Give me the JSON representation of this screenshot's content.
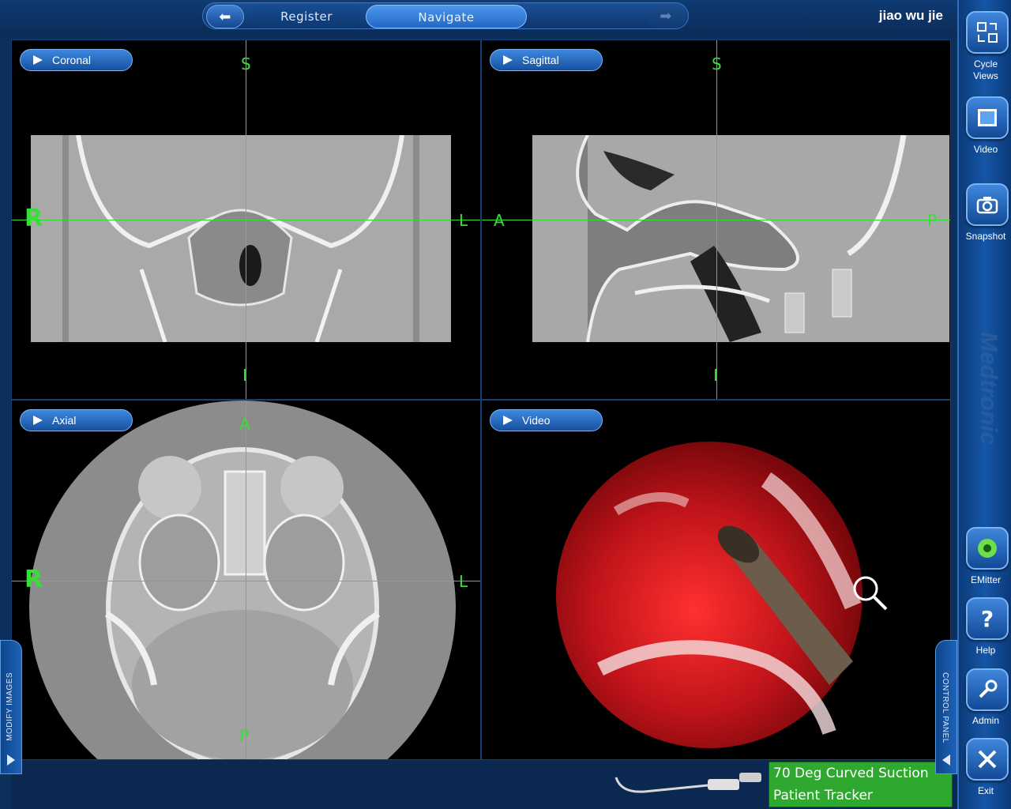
{
  "topbar": {
    "back_icon": "left-arrow-icon",
    "register_label": "Register",
    "navigate_label": "Navigate",
    "forward_icon": "right-arrow-icon",
    "patient_name": "jiao wu jie"
  },
  "views": {
    "coronal": {
      "label": "Coronal",
      "top": "S",
      "bottom": "I",
      "left": "R",
      "right": "L"
    },
    "sagittal": {
      "label": "Sagittal",
      "top": "S",
      "bottom": "I",
      "left": "A",
      "right": "P"
    },
    "axial": {
      "label": "Axial",
      "top": "A",
      "bottom": "P",
      "left": "R",
      "right": "L"
    },
    "video": {
      "label": "Video"
    }
  },
  "right_panel": {
    "cycle_views_label": "Cycle\nViews",
    "video_label": "Video",
    "snapshot_label": "Snapshot",
    "brand": "Medtronic",
    "emitter_label": "EMitter",
    "help_label": "Help",
    "admin_label": "Admin",
    "exit_label": "Exit"
  },
  "drawers": {
    "left_label": "MODIFY IMAGES",
    "right_label": "CONTROL PANEL"
  },
  "tool": {
    "line1": "70 Deg Curved Suction",
    "line2": "Patient Tracker",
    "status_color": "#2fa82f"
  },
  "colors": {
    "crosshair": "#2ee02e",
    "accent": "#2368c4"
  }
}
